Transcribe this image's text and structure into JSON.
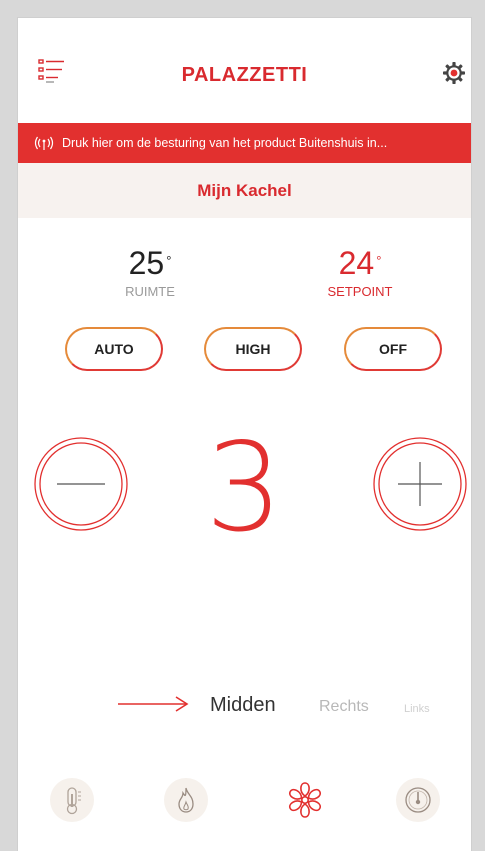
{
  "header": {
    "brand": "PALAZZETTI"
  },
  "banner": {
    "text": "Druk hier om de besturing van het product Buitenshuis in..."
  },
  "stove": {
    "name": "Mijn Kachel"
  },
  "room_temp": {
    "value": "25",
    "unit": "°",
    "label": "RUIMTE"
  },
  "setpoint": {
    "value": "24",
    "unit": "°",
    "label": "SETPOINT"
  },
  "modes": {
    "auto": "AUTO",
    "high": "HIGH",
    "off": "OFF"
  },
  "power": {
    "value": "3"
  },
  "fan": {
    "options": [
      "Midden",
      "Rechts",
      "Links"
    ],
    "selected": "Midden"
  },
  "colors": {
    "accent": "#e2302f",
    "banner": "#e2302f",
    "stove_bar": "#f7f2ef",
    "mode_border_start": "#e58a3a"
  },
  "icons": {
    "menu": "menu-list-icon",
    "settings": "gear-icon",
    "banner": "wifi-signal-icon",
    "minus": "minus-icon",
    "plus": "plus-icon",
    "tabs": [
      "thermometer-icon",
      "flame-icon",
      "fan-icon",
      "gauge-icon"
    ]
  }
}
